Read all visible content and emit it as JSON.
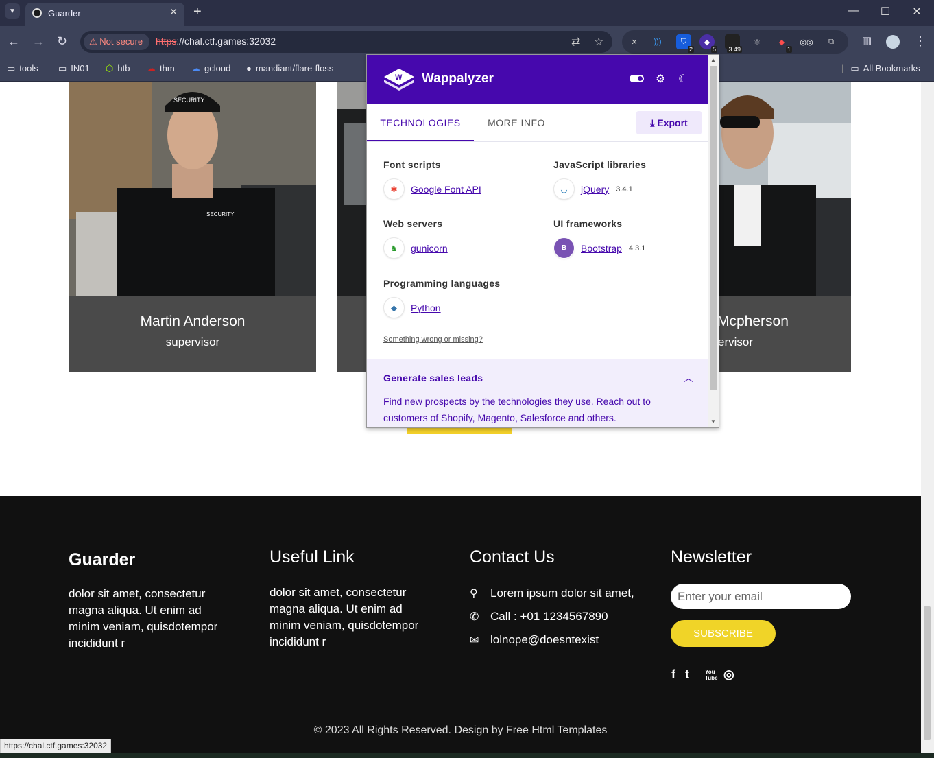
{
  "browser": {
    "tab_title": "Guarder",
    "not_secure": "Not secure",
    "url_scheme": "https",
    "url_rest": "://chal.ctf.games:32032",
    "extensions": [
      {
        "name": "x-icon",
        "badge": ""
      },
      {
        "name": "wifi-icon",
        "badge": ""
      },
      {
        "name": "bitwarden-icon",
        "badge": "2"
      },
      {
        "name": "wappalyzer-icon",
        "badge": "5"
      },
      {
        "name": "lcp-icon",
        "badge": "3.49"
      },
      {
        "name": "react-icon",
        "badge": ""
      },
      {
        "name": "pin-icon",
        "badge": "1"
      },
      {
        "name": "glasses-icon",
        "badge": ""
      },
      {
        "name": "puzzle-icon",
        "badge": ""
      }
    ],
    "bookmarks": [
      "tools",
      "IN01",
      "htb",
      "thm",
      "gcloud",
      "mandiant/flare-floss"
    ],
    "all_bookmarks": "All Bookmarks",
    "status_url": "https://chal.ctf.games:32032"
  },
  "team": [
    {
      "name": "Martin Anderson",
      "role": "supervisor"
    },
    {
      "name": "Mcpherson",
      "role": "ervisor"
    }
  ],
  "footer": {
    "brand": "Guarder",
    "brand_text": "dolor sit amet, consectetur magna aliqua. Ut enim ad minim veniam, quisdotempor incididunt r",
    "useful_title": "Useful Link",
    "useful_text": "dolor sit amet, consectetur magna aliqua. Ut enim ad minim veniam, quisdotempor incididunt r",
    "contact_title": "Contact Us",
    "contact_address": "Lorem ipsum dolor sit amet,",
    "contact_call": "Call : +01 1234567890",
    "contact_email": "lolnope@doesntexist",
    "newsletter_title": "Newsletter",
    "email_placeholder": "Enter your email",
    "subscribe": "SUBSCRIBE",
    "social": [
      "f",
      "t",
      "You Tube",
      "◎"
    ],
    "copyright": "© 2023 All Rights Reserved. Design by Free Html Templates"
  },
  "wappalyzer": {
    "title": "Wappalyzer",
    "tabs": [
      "TECHNOLOGIES",
      "MORE INFO"
    ],
    "export": "Export",
    "categories": [
      {
        "name": "Font scripts",
        "tech": "Google Font API",
        "version": ""
      },
      {
        "name": "JavaScript libraries",
        "tech": "jQuery",
        "version": "3.4.1"
      },
      {
        "name": "Web servers",
        "tech": "gunicorn",
        "version": ""
      },
      {
        "name": "UI frameworks",
        "tech": "Bootstrap",
        "version": "4.3.1"
      },
      {
        "name": "Programming languages",
        "tech": "Python",
        "version": ""
      }
    ],
    "wrong_link": "Something wrong or missing?",
    "leads_title": "Generate sales leads",
    "leads_text": "Find new prospects by the technologies they use. Reach out to customers of Shopify, Magento, Salesforce and others.",
    "brand_color": "#4608ad"
  }
}
